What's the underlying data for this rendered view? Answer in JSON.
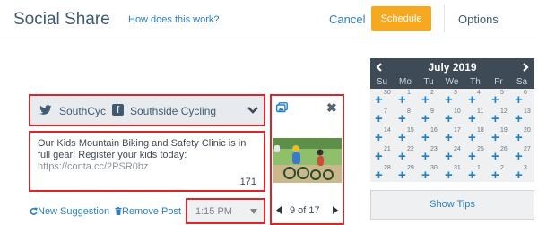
{
  "header": {
    "title": "Social Share",
    "help_link": "How does this work?",
    "cancel_label": "Cancel",
    "schedule_label": "Schedule",
    "options_label": "Options"
  },
  "post": {
    "accounts": [
      {
        "network": "twitter",
        "name": "SouthCyc"
      },
      {
        "network": "facebook",
        "name": "Southside Cycling"
      }
    ],
    "message_text": "Our Kids Mountain Biking and Safety Clinic is in full gear! Register your kids today:",
    "message_link": "https://conta.cc/2PSR0bz",
    "char_count": "171",
    "new_suggestion_label": "New Suggestion",
    "remove_post_label": "Remove Post",
    "time_value": "1:15 PM",
    "image_pager": "9 of 17"
  },
  "calendar": {
    "month_label": "July 2019",
    "day_headers": [
      "Su",
      "Mo",
      "Tu",
      "We",
      "Th",
      "Fr",
      "Sa"
    ],
    "weeks": [
      [
        "30",
        "1",
        "2",
        "3",
        "4",
        "5",
        "6"
      ],
      [
        "7",
        "8",
        "9",
        "10",
        "11",
        "12",
        "13"
      ],
      [
        "14",
        "15",
        "16",
        "17",
        "18",
        "19",
        "20"
      ],
      [
        "21",
        "22",
        "23",
        "24",
        "25",
        "26",
        "27"
      ],
      [
        "28",
        "29",
        "30",
        "31",
        "1",
        "2",
        "3"
      ]
    ]
  },
  "tips_label": "Show Tips",
  "colors": {
    "accent": "#f7a821",
    "link": "#2d7fc1",
    "highlight_border": "#d9262c",
    "calendar_header": "#3f4a57"
  },
  "icons": [
    "twitter-icon",
    "facebook-icon",
    "chevron-down-icon",
    "refresh-icon",
    "trash-icon",
    "image-icon",
    "close-icon",
    "caret-left-icon",
    "caret-right-icon",
    "plus-icon"
  ]
}
